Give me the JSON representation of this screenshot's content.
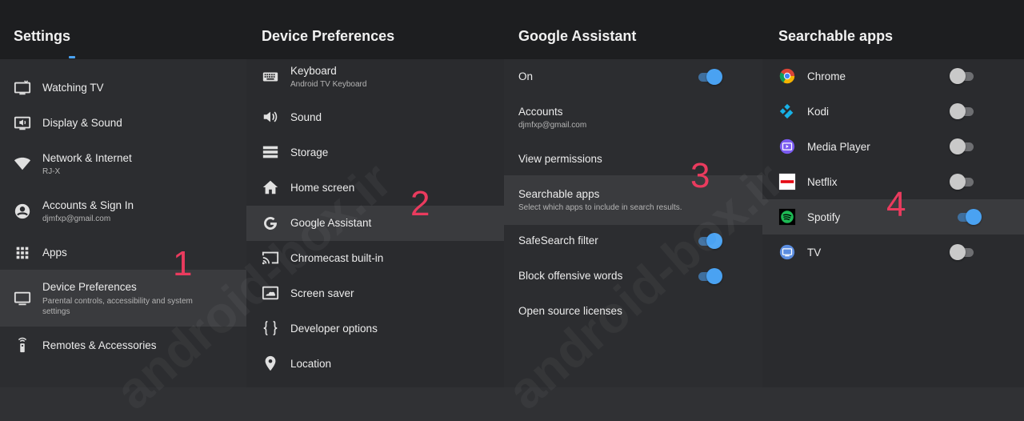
{
  "panels": [
    {
      "title": "Settings",
      "items": [
        {
          "label": "Watching TV",
          "sub": "",
          "icon": "tv-icon"
        },
        {
          "label": "Display & Sound",
          "sub": "",
          "icon": "display-sound-icon"
        },
        {
          "label": "Network & Internet",
          "sub": "RJ-X",
          "icon": "wifi-icon"
        },
        {
          "label": "Accounts & Sign In",
          "sub": "djmfxp@gmail.com",
          "icon": "account-icon"
        },
        {
          "label": "Apps",
          "sub": "",
          "icon": "apps-grid-icon"
        },
        {
          "label": "Device Preferences",
          "sub": "Parental controls, accessibility and system settings",
          "icon": "monitor-icon",
          "selected": true
        },
        {
          "label": "Remotes & Accessories",
          "sub": "",
          "icon": "remote-icon"
        }
      ]
    },
    {
      "title": "Device Preferences",
      "items": [
        {
          "label": "Keyboard",
          "sub": "Android TV Keyboard",
          "icon": "keyboard-icon"
        },
        {
          "label": "Sound",
          "sub": "",
          "icon": "speaker-icon"
        },
        {
          "label": "Storage",
          "sub": "",
          "icon": "storage-icon"
        },
        {
          "label": "Home screen",
          "sub": "",
          "icon": "home-icon"
        },
        {
          "label": "Google Assistant",
          "sub": "",
          "icon": "google-icon",
          "selected": true
        },
        {
          "label": "Chromecast built-in",
          "sub": "",
          "icon": "cast-icon"
        },
        {
          "label": "Screen saver",
          "sub": "",
          "icon": "screensaver-icon"
        },
        {
          "label": "Developer options",
          "sub": "",
          "icon": "braces-icon"
        },
        {
          "label": "Location",
          "sub": "",
          "icon": "location-pin-icon"
        }
      ]
    },
    {
      "title": "Google Assistant",
      "items": [
        {
          "label": "On",
          "sub": "",
          "toggle": "on"
        },
        {
          "label": "Accounts",
          "sub": "djmfxp@gmail.com"
        },
        {
          "label": "View permissions",
          "sub": ""
        },
        {
          "label": "Searchable apps",
          "sub": "Select which apps to include in search results.",
          "selected": true
        },
        {
          "label": "SafeSearch filter",
          "sub": "",
          "toggle": "on"
        },
        {
          "label": "Block offensive words",
          "sub": "",
          "toggle": "on"
        },
        {
          "label": "Open source licenses",
          "sub": ""
        }
      ]
    },
    {
      "title": "Searchable apps",
      "items": [
        {
          "label": "Chrome",
          "icon": "chrome-icon",
          "toggle": "off"
        },
        {
          "label": "Kodi",
          "icon": "kodi-icon",
          "toggle": "off"
        },
        {
          "label": "Media Player",
          "icon": "media-player-icon",
          "toggle": "off"
        },
        {
          "label": "Netflix",
          "icon": "netflix-icon",
          "toggle": "off"
        },
        {
          "label": "Spotify",
          "icon": "spotify-icon",
          "toggle": "on",
          "selected": true
        },
        {
          "label": "TV",
          "icon": "tv-app-icon",
          "toggle": "off"
        }
      ]
    }
  ],
  "step_numbers": [
    "1",
    "2",
    "3",
    "4"
  ],
  "watermark": "android-box.ir",
  "colors": {
    "accent": "#4aa2f2",
    "step_number": "#ea3b5e",
    "header_bg": "#1d1e20",
    "selected_bg": "#3a3b3e"
  }
}
